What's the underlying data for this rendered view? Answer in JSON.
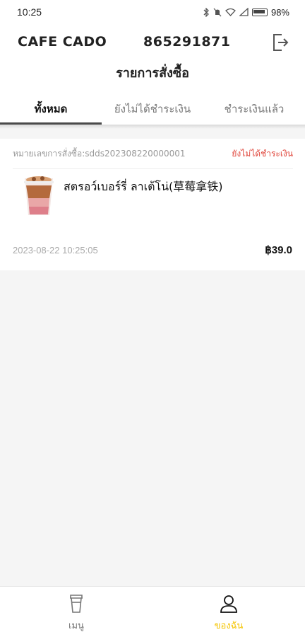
{
  "status_bar": {
    "time": "10:25",
    "battery_percent": "98%",
    "icons": [
      "bluetooth-icon",
      "mute-icon",
      "wifi-icon",
      "signal-icon",
      "battery-icon"
    ]
  },
  "header": {
    "store_name": "CAFE CADO",
    "store_id": "865291871",
    "logout_icon": "logout-icon",
    "page_title": "รายการสั่งซื้อ"
  },
  "tabs": [
    {
      "label": "ทั้งหมด",
      "active": true
    },
    {
      "label": "ยังไม่ได้ชำระเงิน",
      "active": false
    },
    {
      "label": "ชำระเงินแล้ว",
      "active": false
    }
  ],
  "orders": [
    {
      "order_number": "หมายเลขการสั่งซื้อ:sdds202308220000001",
      "status": "ยังไม่ได้ชำระเงิน",
      "product_name": "สตรอว์เบอร์รี่ ลาเต้โน่(草莓拿铁)",
      "date": "2023-08-22 10:25:05",
      "price": "฿39.0"
    }
  ],
  "bottom_nav": [
    {
      "label": "เมนู",
      "icon": "cup-icon",
      "active": false
    },
    {
      "label": "ของฉัน",
      "icon": "user-icon",
      "active": true
    }
  ],
  "colors": {
    "accent_yellow": "#f5c400",
    "status_red": "#e0453a",
    "background": "#f5f5f5"
  }
}
